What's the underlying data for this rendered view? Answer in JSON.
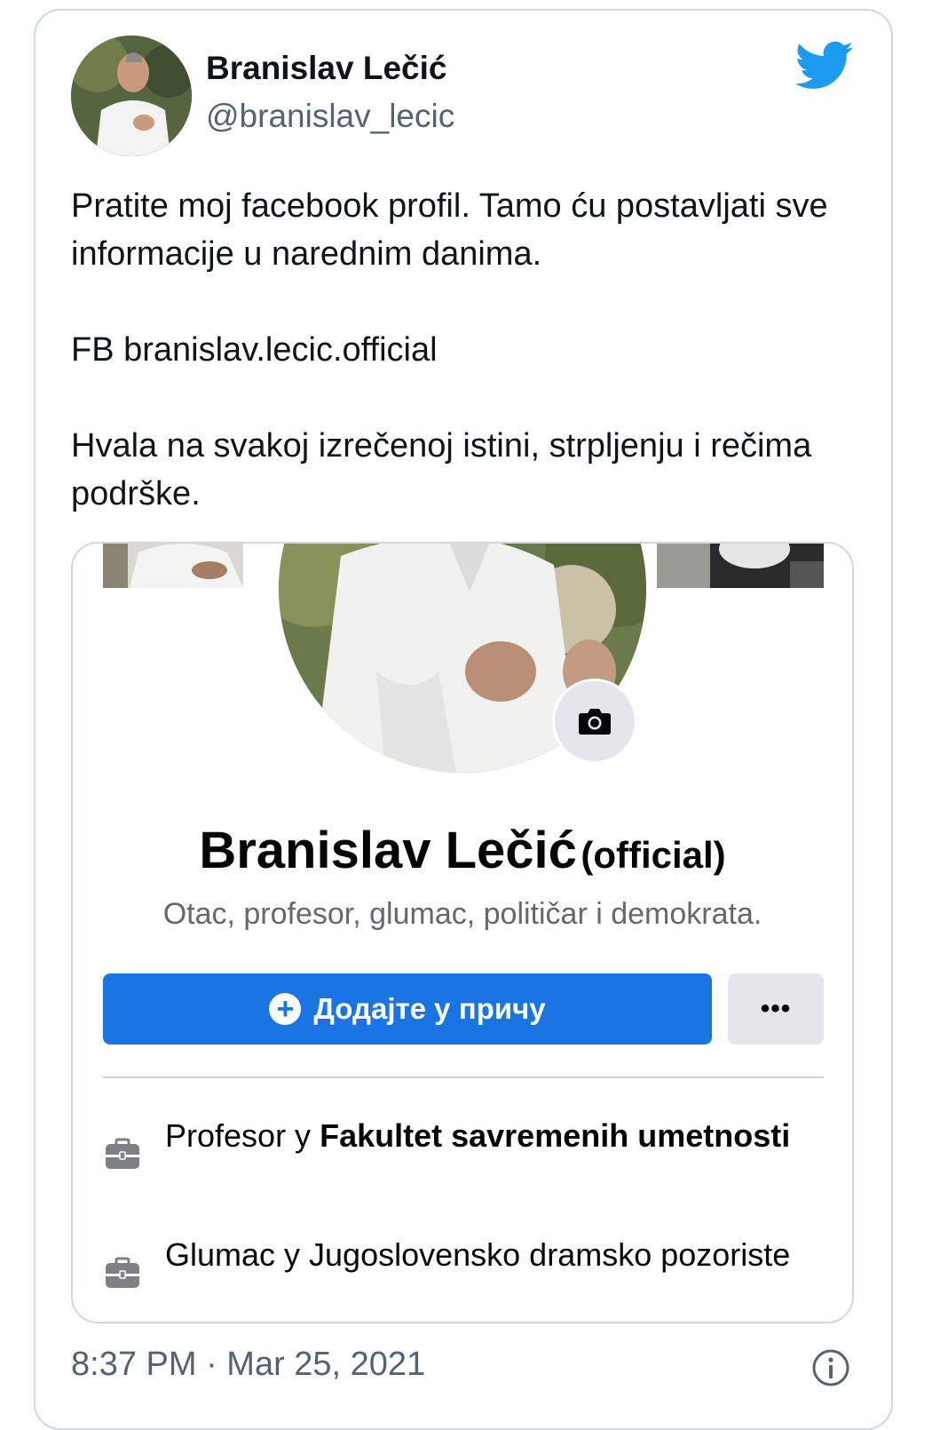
{
  "tweet": {
    "author_name": "Branislav Lečić",
    "author_handle": "@branislav_lecic",
    "paragraphs": [
      "Pratite moj facebook profil. Tamo ću postavljati sve informacije u narednim danima.",
      "FB branislav.lecic.official",
      "Hvala na svakoj izrečenoj istini, strpljenju i rečima podrške."
    ],
    "timestamp": "8:37 PM · Mar 25, 2021"
  },
  "facebook_card": {
    "name": "Branislav Lečić",
    "name_suffix": "(official)",
    "bio": "Otac, profesor, glumac, političar i demokrata.",
    "add_story_label": "Додајте у причу",
    "more_label": "•••",
    "work": [
      {
        "role": "Profesor у",
        "place": "Fakultet savremenih umetnosti"
      },
      {
        "role": "Glumac у Jugoslovensko dramsko pozoriste",
        "place": ""
      }
    ]
  },
  "icons": {
    "brand": "twitter-bird-icon",
    "camera": "camera-icon",
    "work": "briefcase-icon",
    "info": "info-icon"
  },
  "colors": {
    "twitter_blue": "#1d9bf0",
    "facebook_blue": "#1b74e4",
    "secondary_text": "#536471",
    "border": "#cfd9de"
  }
}
